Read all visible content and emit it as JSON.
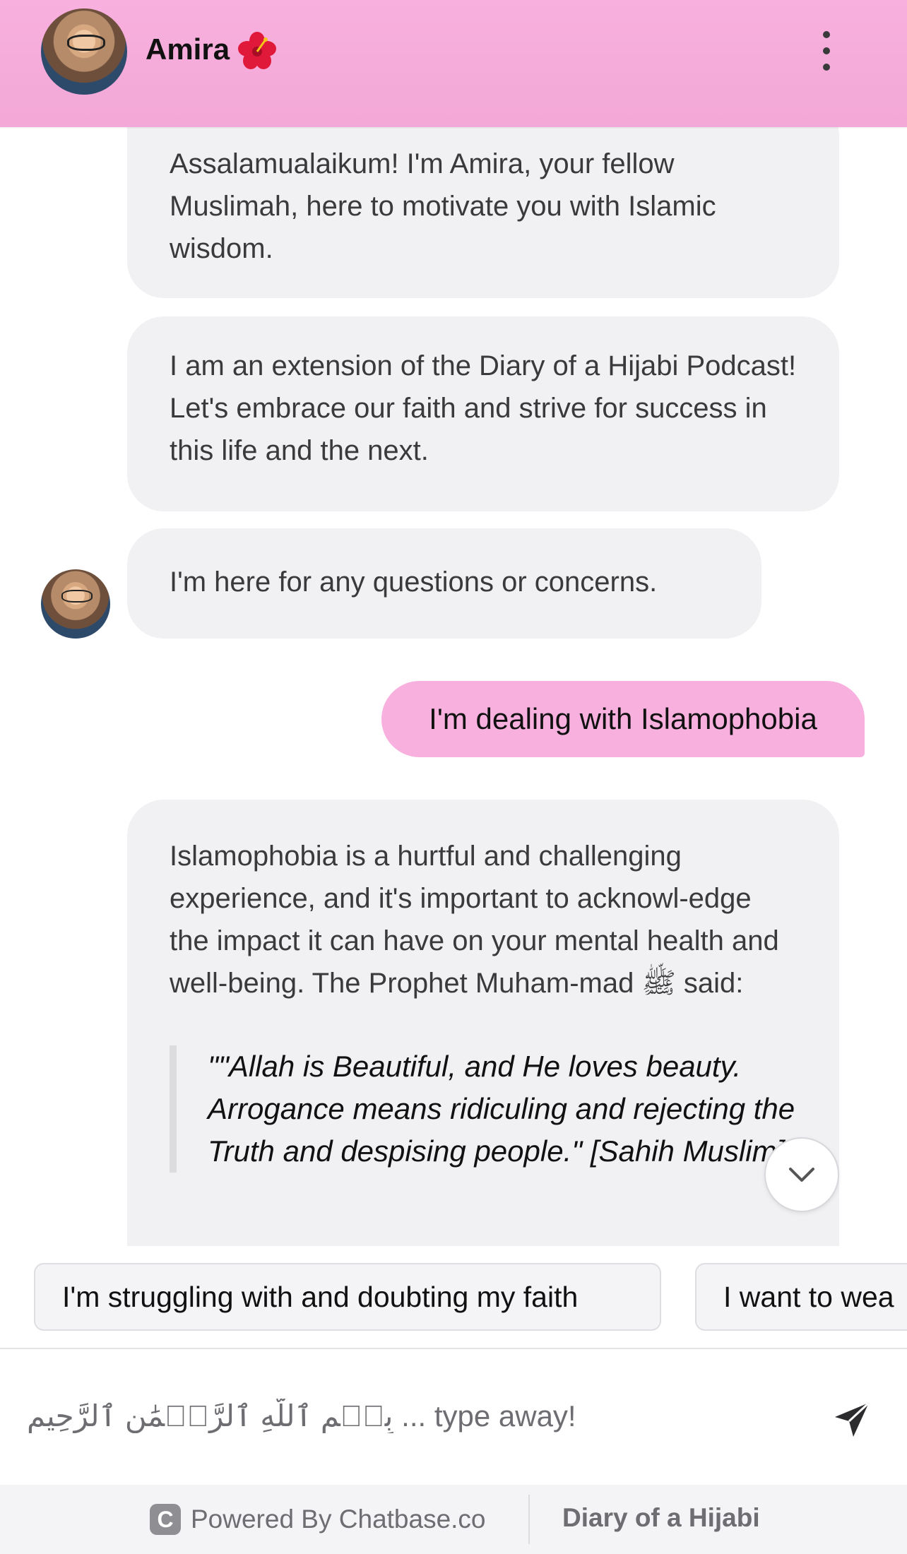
{
  "header": {
    "name": "Amira",
    "flower_icon": "hibiscus-icon",
    "menu_icon": "vertical-dots-icon",
    "bg_color": "#f8b0de"
  },
  "messages": [
    {
      "role": "bot",
      "text": "Assalamualaikum! I'm Amira, your fellow Muslimah, here to motivate you with Islamic wisdom."
    },
    {
      "role": "bot",
      "text": "I am an extension of the Diary of a Hijabi Podcast! Let's embrace our faith and strive for success in this life and the next."
    },
    {
      "role": "bot",
      "text": "I'm here for any questions or concerns."
    },
    {
      "role": "user",
      "text": "I'm dealing with Islamophobia"
    },
    {
      "role": "bot",
      "text": "Islamophobia is a hurtful and challenging experience, and it's important to acknowl-edge the impact it can have on your mental health and well-being. The Prophet Muham-mad ﷺ said:",
      "quote": "\"\"Allah is Beautiful, and He loves beauty. Arrogance means ridiculing and rejecting the Truth and despising people.\" [Sahih Muslim]\""
    }
  ],
  "suggestions": [
    "I'm struggling with and doubting my faith",
    "I want to wea"
  ],
  "input": {
    "placeholder": "بِسۡمِ ٱللَّهِ ٱلرَّحۡمَٰنِ ٱلرَّحِيمِ ... type away!",
    "value": ""
  },
  "footer": {
    "powered_by": "Powered By Chatbase.co",
    "logo_letter": "C",
    "brand": "Diary of a Hijabi"
  },
  "colors": {
    "accent_pink": "#f8b0de",
    "bot_bubble": "#f1f1f3",
    "text": "#3a3a3c"
  }
}
